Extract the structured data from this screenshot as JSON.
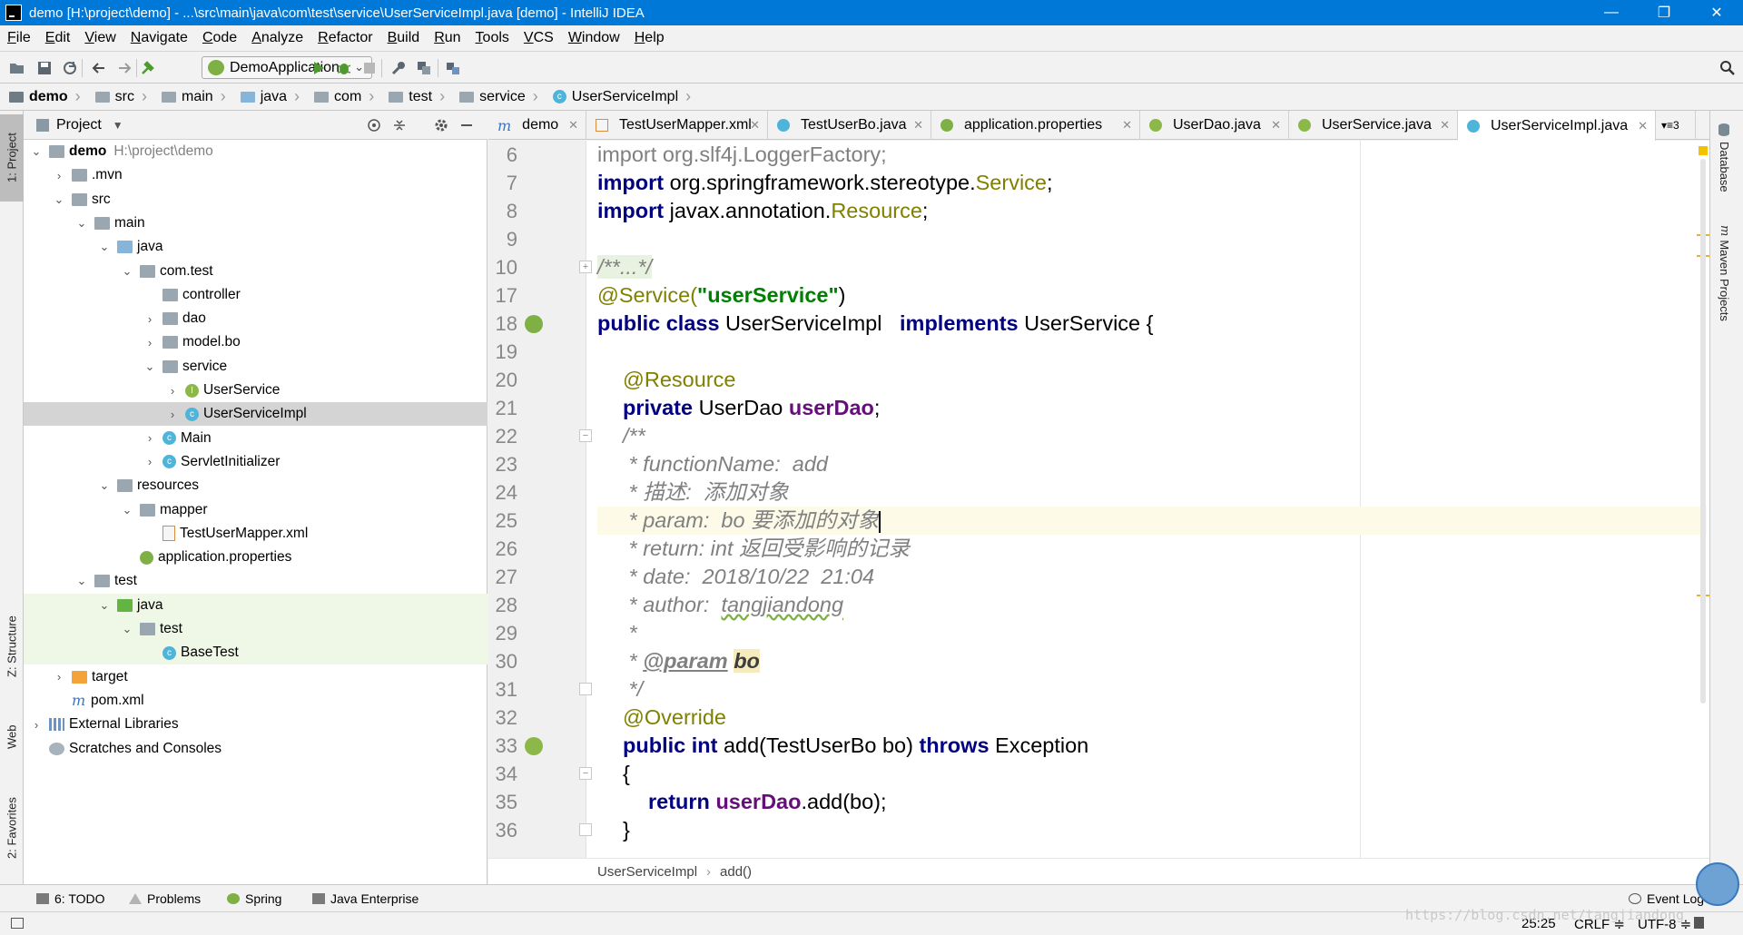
{
  "window": {
    "title": "demo [H:\\project\\demo] - ...\\src\\main\\java\\com\\test\\service\\UserServiceImpl.java [demo] - IntelliJ IDEA",
    "min": "—",
    "max": "❐",
    "close": "✕"
  },
  "menu": [
    "File",
    "Edit",
    "View",
    "Navigate",
    "Code",
    "Analyze",
    "Refactor",
    "Build",
    "Run",
    "Tools",
    "VCS",
    "Window",
    "Help"
  ],
  "toolbar": {
    "run_config": "DemoApplication"
  },
  "breadcrumb": [
    "demo",
    "src",
    "main",
    "java",
    "com",
    "test",
    "service",
    "UserServiceImpl"
  ],
  "left_tabs": {
    "project": "1: Project",
    "structure": "Z: Structure",
    "web": "Web",
    "favorites": "2: Favorites"
  },
  "project_panel": {
    "title": "Project",
    "tree": [
      {
        "label": "demo",
        "sub": "H:\\project\\demo",
        "indent": 0,
        "arrow": "⌄",
        "icon": "folder"
      },
      {
        "label": ".mvn",
        "indent": 1,
        "arrow": "›",
        "icon": "folder"
      },
      {
        "label": "src",
        "indent": 1,
        "arrow": "⌄",
        "icon": "folder"
      },
      {
        "label": "main",
        "indent": 2,
        "arrow": "⌄",
        "icon": "folder"
      },
      {
        "label": "java",
        "indent": 3,
        "arrow": "⌄",
        "icon": "folder-blue"
      },
      {
        "label": "com.test",
        "indent": 4,
        "arrow": "⌄",
        "icon": "pkg"
      },
      {
        "label": "controller",
        "indent": 5,
        "arrow": "",
        "icon": "pkg"
      },
      {
        "label": "dao",
        "indent": 5,
        "arrow": "›",
        "icon": "pkg"
      },
      {
        "label": "model.bo",
        "indent": 5,
        "arrow": "›",
        "icon": "pkg"
      },
      {
        "label": "service",
        "indent": 5,
        "arrow": "⌄",
        "icon": "pkg"
      },
      {
        "label": "UserService",
        "indent": 6,
        "arrow": "›",
        "icon": "interface"
      },
      {
        "label": "UserServiceImpl",
        "indent": 6,
        "arrow": "›",
        "icon": "class"
      },
      {
        "label": "Main",
        "indent": 5,
        "arrow": "›",
        "icon": "class"
      },
      {
        "label": "ServletInitializer",
        "indent": 5,
        "arrow": "›",
        "icon": "class"
      },
      {
        "label": "resources",
        "indent": 3,
        "arrow": "⌄",
        "icon": "folder-res"
      },
      {
        "label": "mapper",
        "indent": 4,
        "arrow": "⌄",
        "icon": "folder"
      },
      {
        "label": "TestUserMapper.xml",
        "indent": 5,
        "arrow": "",
        "icon": "xml"
      },
      {
        "label": "application.properties",
        "indent": 4,
        "arrow": "",
        "icon": "props"
      },
      {
        "label": "test",
        "indent": 2,
        "arrow": "⌄",
        "icon": "folder"
      },
      {
        "label": "java",
        "indent": 3,
        "arrow": "⌄",
        "icon": "folder-green"
      },
      {
        "label": "test",
        "indent": 4,
        "arrow": "⌄",
        "icon": "pkg"
      },
      {
        "label": "BaseTest",
        "indent": 5,
        "arrow": "",
        "icon": "class"
      },
      {
        "label": "target",
        "indent": 1,
        "arrow": "›",
        "icon": "folder-orange"
      },
      {
        "label": "pom.xml",
        "indent": 1,
        "arrow": "",
        "icon": "maven"
      },
      {
        "label": "External Libraries",
        "indent": 0,
        "arrow": "›",
        "icon": "lib"
      },
      {
        "label": "Scratches and Consoles",
        "indent": 0,
        "arrow": "",
        "icon": "scratch"
      }
    ]
  },
  "tabs": [
    {
      "label": "demo",
      "icon": "maven"
    },
    {
      "label": "TestUserMapper.xml",
      "icon": "xml"
    },
    {
      "label": "TestUserBo.java",
      "icon": "class"
    },
    {
      "label": "application.properties",
      "icon": "props"
    },
    {
      "label": "UserDao.java",
      "icon": "interface"
    },
    {
      "label": "UserService.java",
      "icon": "interface"
    },
    {
      "label": "UserServiceImpl.java",
      "icon": "class",
      "active": true
    }
  ],
  "tabs_overflow": "▾≡3",
  "editor": {
    "line_numbers": [
      "6",
      "7",
      "8",
      "9",
      "10",
      "17",
      "18",
      "19",
      "20",
      "21",
      "22",
      "23",
      "24",
      "25",
      "26",
      "27",
      "28",
      "29",
      "30",
      "31",
      "32",
      "33",
      "34",
      "35",
      "36"
    ],
    "lines": {
      "l6": "import org.slf4j.LoggerFactory;",
      "l7_kw": "import",
      "l7_rest": " org.springframework.stereotype.",
      "l7_cls": "Service",
      "l7_end": ";",
      "l8_kw": "import",
      "l8_rest": " javax.annotation.",
      "l8_cls": "Resource",
      "l8_end": ";",
      "l10": "/**...*/",
      "l17_ann": "@Service(",
      "l17_str": "\"userService\"",
      "l17_end": ")",
      "l18_kw1": "public class",
      "l18_name": " UserServiceImpl   ",
      "l18_kw2": "implements",
      "l18_rest": " UserService {",
      "l20_ann": "@Resource",
      "l21_kw": "private",
      "l21_type": " UserDao ",
      "l21_fld": "userDao",
      "l21_end": ";",
      "l22": "/**",
      "l23": " * functionName:  add",
      "l24": " * 描述:  添加对象",
      "l25": " * param:  bo 要添加的对象",
      "l26": " * return: int 返回受影响的记录",
      "l27": " * date:  2018/10/22  21:04",
      "l28_pre": " * author:  ",
      "l28_name": "tangjiandong",
      "l29": " *",
      "l30_pre": " * ",
      "l30_tag": "@param",
      "l30_sp": " ",
      "l30_p": "bo",
      "l31": " */",
      "l32_ann": "@Override",
      "l33_kw1": "public int",
      "l33_mid": " add(TestUserBo bo) ",
      "l33_kw2": "throws",
      "l33_end": " Exception",
      "l34": "{",
      "l35_kw": "return",
      "l35_sp": " ",
      "l35_fld": "userDao",
      "l35_end": ".add(bo);",
      "l36": "}"
    }
  },
  "editor_breadcrumb": {
    "cls": "UserServiceImpl",
    "method": "add()"
  },
  "right_tabs": {
    "database": "Database",
    "maven": "Maven Projects"
  },
  "bottom_tools": {
    "todo": "6: TODO",
    "problems": "Problems",
    "spring": "Spring",
    "javaee": "Java Enterprise",
    "eventlog": "Event Log"
  },
  "status": {
    "position": "25:25",
    "line_sep": "CRLF ≑",
    "encoding": "UTF-8 ≑"
  },
  "watermark": "https://blog.csdn.net/tangjiandong"
}
